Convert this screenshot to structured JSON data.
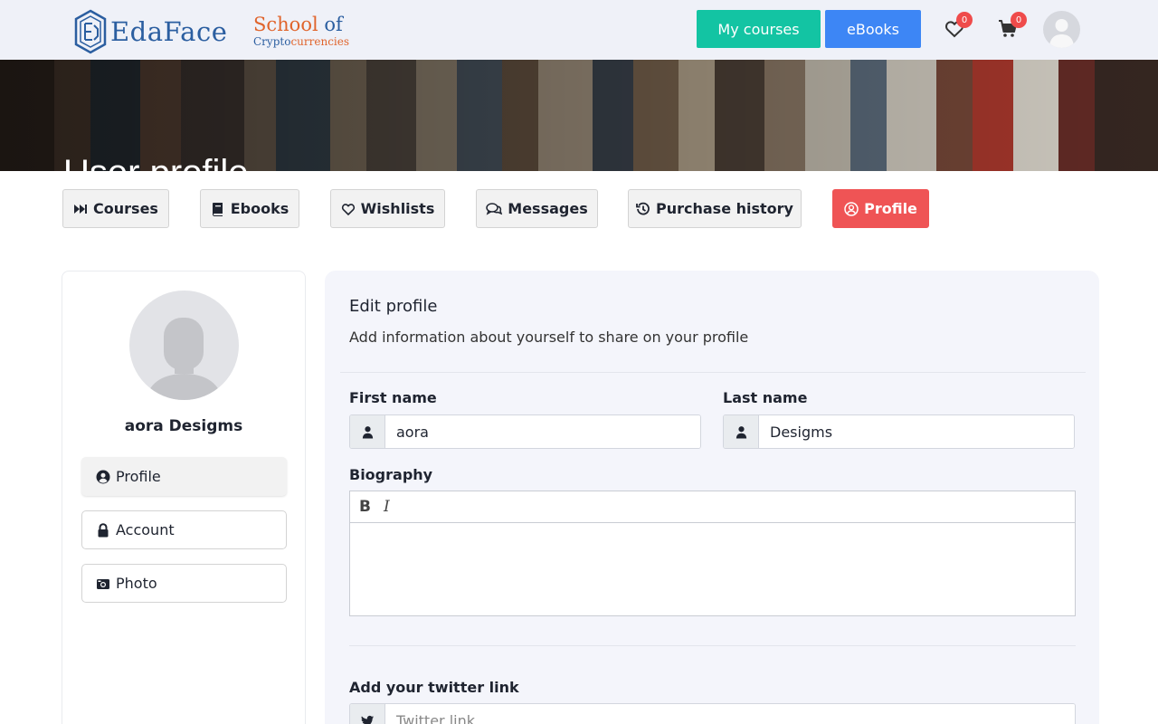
{
  "header": {
    "logo": {
      "part1": "Eda",
      "part2": "Face"
    },
    "school": {
      "line1_a": "School",
      "line1_b": "of",
      "line2_a": "Crypto",
      "line2_b": "currencies"
    },
    "my_courses_label": "My courses",
    "ebooks_label": "eBooks",
    "wishlist_count": "0",
    "cart_count": "0"
  },
  "banner": {
    "title": "User profile"
  },
  "tabs": [
    {
      "label": "Courses",
      "icon": "forward-step-icon"
    },
    {
      "label": "Ebooks",
      "icon": "book-icon"
    },
    {
      "label": "Wishlists",
      "icon": "heart-icon"
    },
    {
      "label": "Messages",
      "icon": "comments-icon"
    },
    {
      "label": "Purchase history",
      "icon": "history-icon"
    },
    {
      "label": "Profile",
      "icon": "user-circle-icon",
      "active": true
    }
  ],
  "sidebar": {
    "user_name": "aora Desigms",
    "items": [
      {
        "label": "Profile",
        "icon": "user-circle-icon",
        "active": true
      },
      {
        "label": "Account",
        "icon": "lock-icon"
      },
      {
        "label": "Photo",
        "icon": "camera-icon"
      }
    ]
  },
  "form": {
    "title": "Edit profile",
    "subtitle": "Add information about yourself to share on your profile",
    "first_name_label": "First name",
    "first_name_value": "aora",
    "last_name_label": "Last name",
    "last_name_value": "Desigms",
    "biography_label": "Biography",
    "bold_label": "B",
    "italic_label": "I",
    "twitter_label": "Add your twitter link",
    "twitter_placeholder": "Twitter link"
  },
  "colors": {
    "accent_green": "#13c4a3",
    "accent_blue": "#3d86f5",
    "active_red": "#ef5455",
    "badge_red": "#ef4b4b"
  }
}
